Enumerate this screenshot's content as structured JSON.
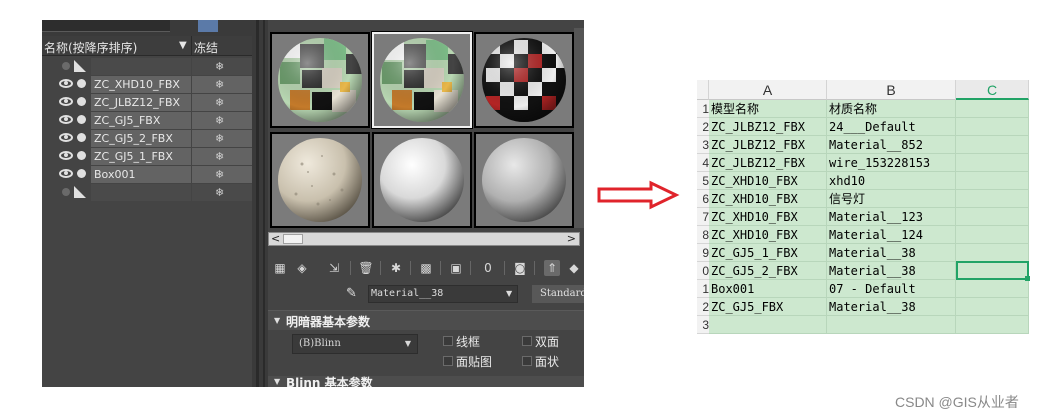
{
  "explorer": {
    "header_name": "名称(按降序排序)",
    "header_sort_icon": "▼",
    "header_freeze": "冻结",
    "freeze_glyph": "❄",
    "rows": [
      {
        "label": "",
        "kind": "root"
      },
      {
        "label": "ZC_XHD10_FBX",
        "kind": "object"
      },
      {
        "label": "ZC_JLBZ12_FBX",
        "kind": "object"
      },
      {
        "label": "ZC_GJ5_FBX",
        "kind": "object"
      },
      {
        "label": "ZC_GJ5_2_FBX",
        "kind": "object"
      },
      {
        "label": "ZC_GJ5_1_FBX",
        "kind": "object"
      },
      {
        "label": "Box001",
        "kind": "object"
      },
      {
        "label": "",
        "kind": "root"
      }
    ]
  },
  "material_editor": {
    "current_material": "Material__38",
    "material_type": "Standard",
    "rollout_shader": "明暗器基本参数",
    "shader_type": "(B)Blinn",
    "options": [
      "线框",
      "双面",
      "面贴图",
      "面状"
    ],
    "rollout_blinn": "Blinn 基本参数",
    "scroll_left": "<",
    "scroll_right": ">",
    "dropdown_glyph": "▼"
  },
  "spreadsheet": {
    "columns": [
      "A",
      "B",
      "C"
    ],
    "selected_column": "C",
    "row_numbers": [
      "1",
      "2",
      "3",
      "4",
      "5",
      "6",
      "7",
      "8",
      "9",
      "0",
      "1",
      "2",
      "3",
      "4"
    ],
    "rows": [
      [
        "模型名称",
        "材质名称",
        ""
      ],
      [
        "ZC_JLBZ12_FBX",
        "24___Default",
        ""
      ],
      [
        "ZC_JLBZ12_FBX",
        "Material__852",
        ""
      ],
      [
        "ZC_JLBZ12_FBX",
        "wire_153228153",
        ""
      ],
      [
        "ZC_XHD10_FBX",
        "xhd10",
        ""
      ],
      [
        "ZC_XHD10_FBX",
        "信号灯",
        ""
      ],
      [
        "ZC_XHD10_FBX",
        "Material__123",
        ""
      ],
      [
        "ZC_XHD10_FBX",
        "Material__124",
        ""
      ],
      [
        "ZC_GJ5_1_FBX",
        "Material__38",
        ""
      ],
      [
        "ZC_GJ5_2_FBX",
        "Material__38",
        ""
      ],
      [
        "Box001",
        "07 - Default",
        ""
      ],
      [
        "ZC_GJ5_FBX",
        "Material__38",
        ""
      ],
      [
        "",
        "",
        ""
      ]
    ],
    "selection_color": "#21a366",
    "fill_color": "#cde8cf"
  },
  "watermark": "CSDN @GIS从业者",
  "colors": {
    "arrow": "#e0242b",
    "panel_dark": "#444444"
  }
}
